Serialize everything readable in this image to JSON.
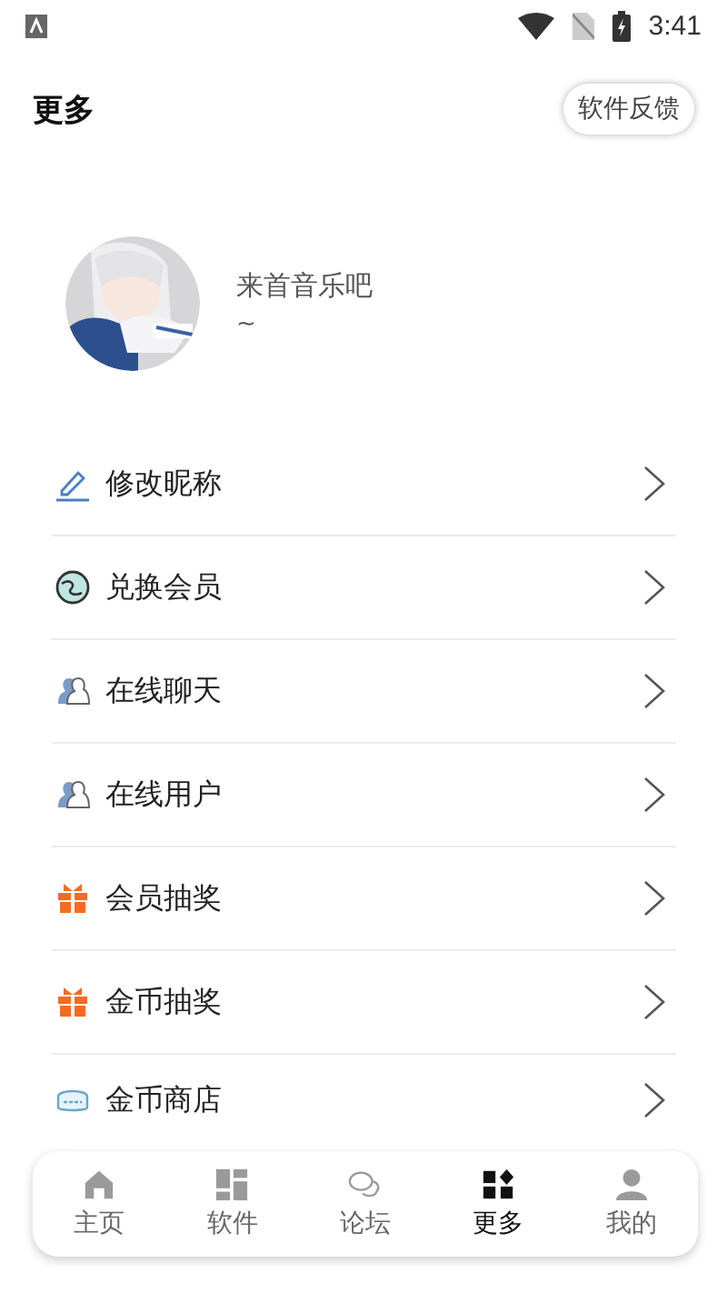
{
  "status_bar": {
    "time": "3:41"
  },
  "header": {
    "title": "更多",
    "feedback_button": "软件反馈"
  },
  "profile": {
    "name": "来首音乐吧",
    "signature": "~"
  },
  "menu": [
    {
      "label": "修改昵称",
      "kind": "pen"
    },
    {
      "label": "兑换会员",
      "kind": "globe"
    },
    {
      "label": "在线聊天",
      "kind": "person"
    },
    {
      "label": "在线用户",
      "kind": "person"
    },
    {
      "label": "会员抽奖",
      "kind": "gift"
    },
    {
      "label": "金币抽奖",
      "kind": "gift"
    },
    {
      "label": "金币商店",
      "kind": "shop"
    }
  ],
  "bottom_nav": [
    {
      "label": "主页",
      "kind": "home",
      "selected": false
    },
    {
      "label": "软件",
      "kind": "apps",
      "selected": false
    },
    {
      "label": "论坛",
      "kind": "forum",
      "selected": false
    },
    {
      "label": "更多",
      "kind": "more",
      "selected": true
    },
    {
      "label": "我的",
      "kind": "profile",
      "selected": false
    }
  ]
}
